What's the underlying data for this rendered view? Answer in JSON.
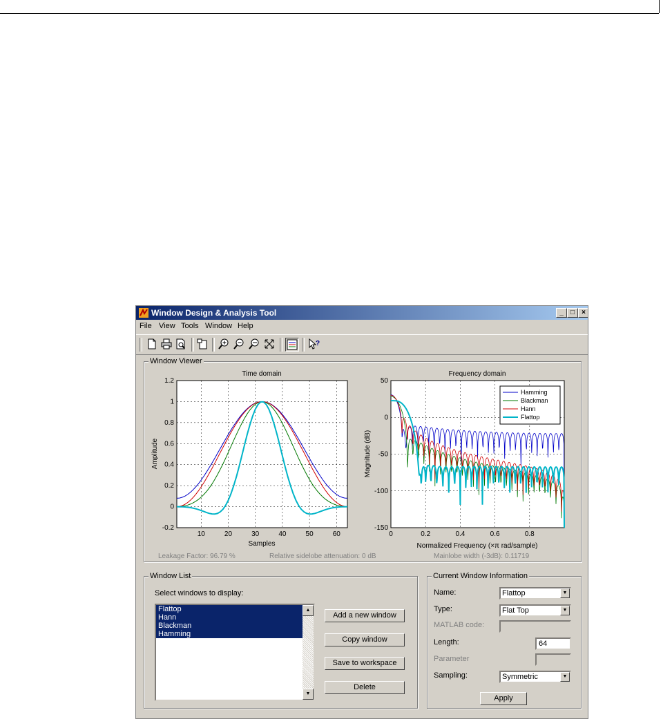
{
  "window": {
    "title": "Window Design & Analysis Tool",
    "controls": {
      "minimize": "_",
      "maximize": "□",
      "close": "×"
    }
  },
  "menu": [
    "File",
    "View",
    "Tools",
    "Window",
    "Help"
  ],
  "toolbar_icons": [
    "new-icon",
    "print-icon",
    "print-preview-icon",
    "new-figure-icon",
    "zoom-in-icon",
    "zoom-out-icon",
    "zoom-x-icon",
    "full-view-icon",
    "legend-icon",
    "whats-this-icon"
  ],
  "window_viewer": {
    "label": "Window Viewer",
    "time": {
      "title": "Time domain",
      "xlabel": "Samples",
      "ylabel": "Amplitude",
      "yticks": [
        "1.2",
        "1",
        "0.8",
        "0.6",
        "0.4",
        "0.2",
        "0",
        "-0.2"
      ],
      "xticks": [
        "10",
        "20",
        "30",
        "40",
        "50",
        "60"
      ]
    },
    "freq": {
      "title": "Frequency domain",
      "xlabel": "Normalized Frequency  (×π rad/sample)",
      "ylabel": "Magnitude (dB)",
      "yticks": [
        "50",
        "0",
        "-50",
        "-100",
        "-150"
      ],
      "xticks": [
        "0",
        "0.2",
        "0.4",
        "0.6",
        "0.8"
      ]
    },
    "legend": [
      "Hamming",
      "Blackman",
      "Hann",
      "Flattop"
    ],
    "status": {
      "leakage": "Leakage Factor: 96.79 %",
      "sidelobe": "Relative sidelobe attenuation: 0 dB",
      "mainlobe": "Mainlobe width (-3dB): 0.11719"
    }
  },
  "window_list": {
    "label": "Window List",
    "prompt": "Select windows to display:",
    "items": [
      "Flattop",
      "Hann",
      "Blackman",
      "Hamming"
    ],
    "buttons": {
      "add": "Add a new window",
      "copy": "Copy window",
      "save": "Save to workspace",
      "delete": "Delete"
    }
  },
  "current": {
    "label": "Current Window Information",
    "name_label": "Name:",
    "name_value": "Flattop",
    "type_label": "Type:",
    "type_value": "Flat Top",
    "code_label": "MATLAB code:",
    "length_label": "Length:",
    "length_value": "64",
    "param_label": "Parameter",
    "sampling_label": "Sampling:",
    "sampling_value": "Symmetric",
    "apply": "Apply"
  },
  "colors": {
    "hamming": "#0000c8",
    "blackman": "#007800",
    "hann": "#d00000",
    "flattop": "#00b4c8",
    "selection": "#0a246a"
  },
  "chart_data": [
    {
      "type": "line",
      "title": "Time domain",
      "xlabel": "Samples",
      "ylabel": "Amplitude",
      "xlim": [
        1,
        64
      ],
      "ylim": [
        -0.2,
        1.2
      ],
      "grid": true,
      "series": [
        {
          "name": "Hamming",
          "function": "hamming",
          "length": 64
        },
        {
          "name": "Blackman",
          "function": "blackman",
          "length": 64
        },
        {
          "name": "Hann",
          "function": "hann",
          "length": 64
        },
        {
          "name": "Flattop",
          "function": "flattop",
          "length": 64
        }
      ]
    },
    {
      "type": "line",
      "title": "Frequency domain",
      "xlabel": "Normalized Frequency  (×π rad/sample)",
      "ylabel": "Magnitude (dB)",
      "xlim": [
        0,
        1
      ],
      "ylim": [
        -150,
        50
      ],
      "grid": true,
      "legend": "top-right",
      "series": [
        {
          "name": "Hamming",
          "sidelobe_floor_db": -35
        },
        {
          "name": "Blackman",
          "sidelobe_floor_db": -100
        },
        {
          "name": "Hann",
          "sidelobe_floor_db": -100
        },
        {
          "name": "Flattop",
          "sidelobe_floor_db": -70
        }
      ]
    }
  ]
}
